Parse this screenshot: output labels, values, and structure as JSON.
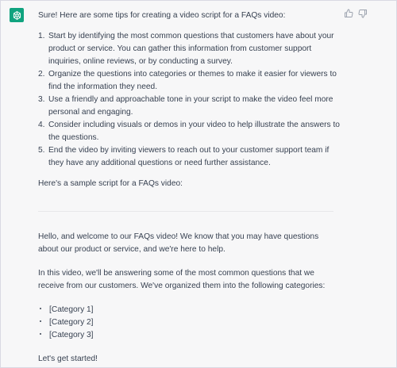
{
  "message": {
    "avatar_icon": "openai-logo-icon",
    "brand_color": "#10a37f",
    "intro": "Sure! Here are some tips for creating a video script for a FAQs video:",
    "tips": [
      "Start by identifying the most common questions that customers have about your product or service. You can gather this information from customer support inquiries, online reviews, or by conducting a survey.",
      "Organize the questions into categories or themes to make it easier for viewers to find the information they need.",
      "Use a friendly and approachable tone in your script to make the video feel more personal and engaging.",
      "Consider including visuals or demos in your video to help illustrate the answers to the questions.",
      "End the video by inviting viewers to reach out to your customer support team if they have any additional questions or need further assistance."
    ],
    "sample_intro": "Here's a sample script for a FAQs video:",
    "script": {
      "para1": "Hello, and welcome to our FAQs video! We know that you may have questions about our product or service, and we're here to help.",
      "para2": "In this video, we'll be answering some of the most common questions that we receive from our customers. We've organized them into the following categories:",
      "categories": [
        "[Category 1]",
        "[Category 2]",
        "[Category 3]"
      ],
      "closing": "Let's get started!"
    }
  },
  "feedback": {
    "thumbs_up_icon": "thumbs-up-icon",
    "thumbs_down_icon": "thumbs-down-icon"
  }
}
